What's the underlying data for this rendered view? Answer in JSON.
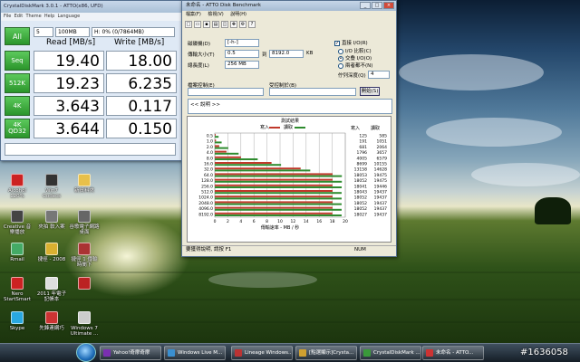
{
  "crystal": {
    "title": "CrystalDiskMark 3.0.1 - ATTO(x86, UFD)",
    "menu": [
      "File",
      "Edit",
      "Theme",
      "Help",
      "Language"
    ],
    "all_label": "All",
    "passes": "5",
    "size": "100MB",
    "drive": "H: 0% (0/7864MB)",
    "read_header": "Read [MB/s]",
    "write_header": "Write [MB/s]",
    "rows": [
      {
        "label": "Seq",
        "read": "19.40",
        "write": "18.00"
      },
      {
        "label": "512K",
        "read": "19.23",
        "write": "6.235"
      },
      {
        "label": "4K",
        "read": "3.643",
        "write": "0.117"
      },
      {
        "label": "4K\nQD32",
        "read": "3.644",
        "write": "0.150"
      }
    ]
  },
  "atto": {
    "title": "未命名 - ATTO Disk Benchmark",
    "menu": [
      "檔案(F)",
      "檢視(V)",
      "說明(H)"
    ],
    "drive_label": "磁碟機(D)",
    "drive_value": "[-h-]",
    "transfer_label": "傳輸大小(T)",
    "transfer_from": "0.5",
    "transfer_to_label": "到",
    "transfer_to": "8192.0",
    "transfer_unit": "KB",
    "length_label": "總長度(L)",
    "length_value": "256 MB",
    "direct_io": "直接 I/O(R)",
    "io_compare": "I/O 比較(C)",
    "overlapped_io": "交叠 I/O(O)",
    "neither": "兩者都不(N)",
    "queue_label": "佇列深度(Q)",
    "queue_value": "4",
    "control_label": "檔案控制(E)",
    "verify_label": "受控制於(B)",
    "start_button": "開始(S)",
    "description": "<< 說明 >>",
    "chart_title": "測試結果",
    "legend_write": "寫入",
    "legend_read": "讀取",
    "col_write": "寫入",
    "col_read": "讀取",
    "xaxis_label": "傳輸速率 - MB / 秒",
    "status_text": "要獲得說明, 請按 F1",
    "status_num": "NUM"
  },
  "chart_data": {
    "type": "bar",
    "orientation": "horizontal",
    "title": "測試結果",
    "xlabel": "傳輸速率 - MB / 秒",
    "xlim": [
      0,
      20
    ],
    "xticks": [
      "0",
      "2",
      "4",
      "6",
      "8",
      "10",
      "12",
      "14",
      "16",
      "18",
      "20"
    ],
    "categories": [
      "0.5",
      "1.0",
      "2.0",
      "4.0",
      "8.0",
      "16.0",
      "32.0",
      "64.0",
      "128.0",
      "256.0",
      "512.0",
      "1024.0",
      "2048.0",
      "4096.0",
      "8192.0"
    ],
    "series": [
      {
        "name": "寫入",
        "color": "#c0392b",
        "values": [
          125,
          191,
          681,
          1796,
          4005,
          8699,
          13158,
          18053,
          18052,
          18041,
          18043,
          18052,
          18052,
          18052,
          18027
        ]
      },
      {
        "name": "讀取",
        "color": "#2e8b2e",
        "values": [
          585,
          1051,
          2064,
          3657,
          6579,
          10155,
          14628,
          19475,
          19475,
          19446,
          19437,
          19437,
          19437,
          19437,
          19437
        ]
      }
    ]
  },
  "desktop": {
    "icons": [
      {
        "label": "Alcohol 120%",
        "name": "alcohol-icon",
        "color": "#c22"
      },
      {
        "label": "Win7 Codecs",
        "name": "codecs-icon",
        "color": "#333"
      },
      {
        "label": "新資料夾",
        "name": "folder-icon",
        "color": "#e8c04a"
      },
      {
        "label": "Creative 音樂播放",
        "name": "creative-icon",
        "color": "#444"
      },
      {
        "label": "夾拍 軟入案",
        "name": "capture-icon",
        "color": "#777"
      },
      {
        "label": "谷歌電子網路桌面",
        "name": "google-desktop-icon",
        "color": "#666"
      },
      {
        "label": "Rmail",
        "name": "rmail-icon",
        "color": "#4a6"
      },
      {
        "label": "捷徑 - 2008",
        "name": "shortcut-icon",
        "color": "#d9b030"
      },
      {
        "label": "捷徑 1 傳輸時間下",
        "name": "shortcut2-icon",
        "color": "#a33"
      },
      {
        "label": "Nero StartSmart",
        "name": "nero-icon",
        "color": "#c22"
      },
      {
        "label": "2011 年電子記帳本",
        "name": "ledger-icon",
        "color": "#ddd"
      },
      {
        "label": "",
        "name": "flag-icon",
        "color": "#b22"
      },
      {
        "label": "Skype",
        "name": "skype-icon",
        "color": "#29a8e0"
      },
      {
        "label": "先鋒連網巧",
        "name": "pioneer-icon",
        "color": "#c33"
      },
      {
        "label": "Windows 7 Ultimate ...",
        "name": "win7-icon",
        "color": "#ccc"
      }
    ]
  },
  "taskbar": {
    "buttons": [
      {
        "label": "Yahoo!奇摩奇摩",
        "color": "#7a2fb0"
      },
      {
        "label": "Windows Live M...",
        "color": "#3a8fd0"
      },
      {
        "label": "Lineage Windows...",
        "color": "#b33"
      },
      {
        "label": "[點選顯示]Crysta...",
        "color": "#d0a030"
      },
      {
        "label": "CrystalDiskMark ...",
        "color": "#3a9a3a"
      },
      {
        "label": "未命名 - ATTO...",
        "color": "#cc3333"
      }
    ],
    "watermark": "#1636058"
  }
}
